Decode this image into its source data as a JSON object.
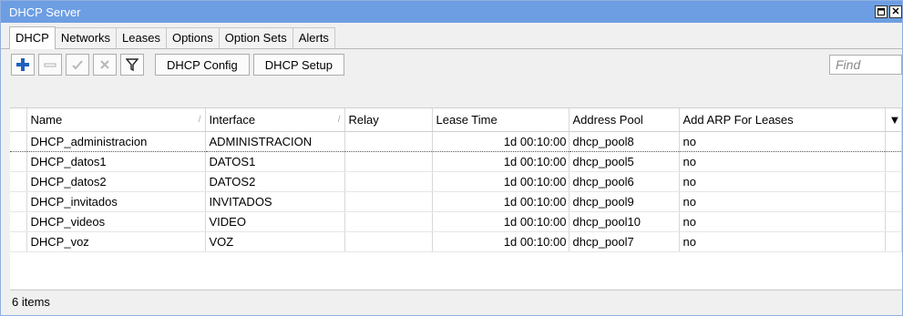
{
  "window": {
    "title": "DHCP Server"
  },
  "tabs": [
    {
      "label": "DHCP",
      "active": true
    },
    {
      "label": "Networks"
    },
    {
      "label": "Leases"
    },
    {
      "label": "Options"
    },
    {
      "label": "Option Sets"
    },
    {
      "label": "Alerts"
    }
  ],
  "toolbar": {
    "dhcp_config_label": "DHCP Config",
    "dhcp_setup_label": "DHCP Setup",
    "find_placeholder": "Find"
  },
  "table": {
    "columns": [
      "Name",
      "Interface",
      "Relay",
      "Lease Time",
      "Address Pool",
      "Add ARP For Leases"
    ],
    "rows": [
      {
        "name": "DHCP_administracion",
        "interface": "ADMINISTRACION",
        "relay": "",
        "lease": "1d 00:10:00",
        "pool": "dhcp_pool8",
        "arp": "no"
      },
      {
        "name": "DHCP_datos1",
        "interface": "DATOS1",
        "relay": "",
        "lease": "1d 00:10:00",
        "pool": "dhcp_pool5",
        "arp": "no"
      },
      {
        "name": "DHCP_datos2",
        "interface": "DATOS2",
        "relay": "",
        "lease": "1d 00:10:00",
        "pool": "dhcp_pool6",
        "arp": "no"
      },
      {
        "name": "DHCP_invitados",
        "interface": "INVITADOS",
        "relay": "",
        "lease": "1d 00:10:00",
        "pool": "dhcp_pool9",
        "arp": "no"
      },
      {
        "name": "DHCP_videos",
        "interface": "VIDEO",
        "relay": "",
        "lease": "1d 00:10:00",
        "pool": "dhcp_pool10",
        "arp": "no"
      },
      {
        "name": "DHCP_voz",
        "interface": "VOZ",
        "relay": "",
        "lease": "1d 00:10:00",
        "pool": "dhcp_pool7",
        "arp": "no"
      }
    ]
  },
  "status": {
    "item_count": "6 items"
  },
  "colors": {
    "titlebar": "#6d9ee3",
    "add_icon": "#1f5fbf"
  }
}
